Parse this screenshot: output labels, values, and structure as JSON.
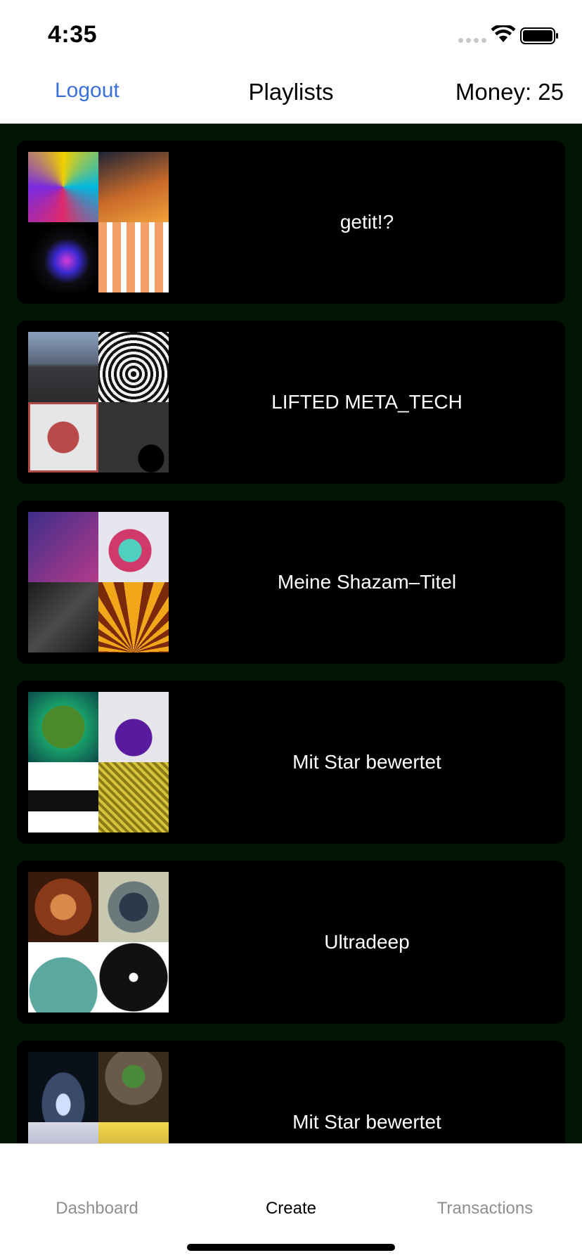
{
  "status": {
    "time": "4:35",
    "icons": [
      "cellular-signal-icon",
      "wifi-icon",
      "battery-icon"
    ]
  },
  "nav": {
    "logout_label": "Logout",
    "title": "Playlists",
    "money": "Money: 25"
  },
  "playlists": [
    {
      "title": "getit!?"
    },
    {
      "title": "LIFTED META_TECH"
    },
    {
      "title": "Meine Shazam–Titel"
    },
    {
      "title": "Mit Star bewertet"
    },
    {
      "title": "Ultradeep"
    },
    {
      "title": "Mit Star bewertet"
    }
  ],
  "tabs": {
    "dashboard": "Dashboard",
    "create": "Create",
    "transactions": "Transactions"
  },
  "colors": {
    "accent": "#3b6fd9",
    "content_background": "#031603",
    "card_background": "#000000"
  }
}
